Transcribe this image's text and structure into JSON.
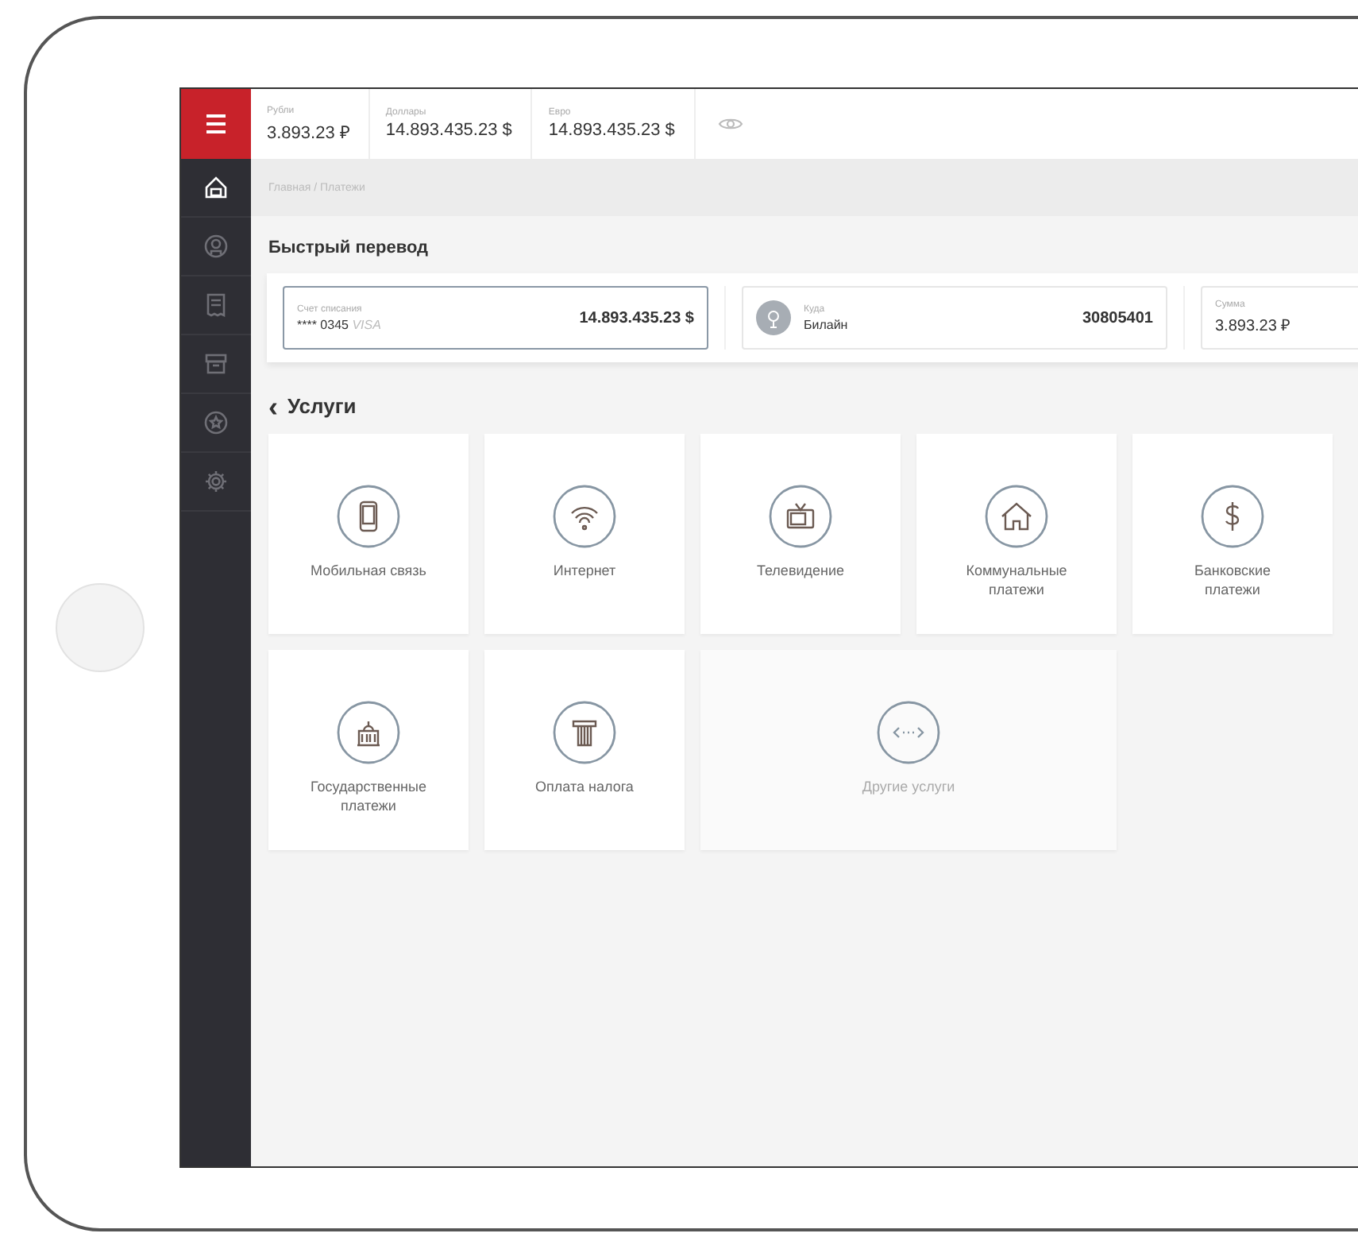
{
  "sidebar": {
    "items": [
      {
        "selected": true
      },
      {
        "selected": false
      },
      {
        "selected": false
      },
      {
        "selected": false
      },
      {
        "selected": false
      },
      {
        "selected": false
      }
    ]
  },
  "balances": [
    {
      "label": "Рубли",
      "value": "3.893.23 ₽"
    },
    {
      "label": "Доллары",
      "value": "14.893.435.23 $"
    },
    {
      "label": "Евро",
      "value": "14.893.435.23 $"
    }
  ],
  "breadcrumb": "Главная / Платежи",
  "quick_transfer": {
    "title": "Быстрый перевод",
    "from": {
      "label": "Счет списания",
      "card": "**** 0345",
      "brand": "VISA",
      "amount": "14.893.435.23 $"
    },
    "to": {
      "label": "Куда",
      "value": "Билайн",
      "number": "30805401"
    },
    "sum": {
      "label": "Сумма",
      "value": "3.893.23 ₽"
    }
  },
  "services": {
    "title": "Услуги",
    "back_icon": "‹",
    "items": [
      {
        "kind": "tile",
        "label": "Мобильная связь"
      },
      {
        "kind": "tile",
        "label": "Интернет"
      },
      {
        "kind": "tile",
        "label": "Телевидение"
      },
      {
        "kind": "tile",
        "label": "Коммунальные платежи"
      },
      {
        "kind": "tile",
        "label": "Банковские платежи"
      },
      {
        "kind": "tile",
        "label": "Государственные платежи"
      },
      {
        "kind": "tile",
        "label": "Оплата налога"
      },
      {
        "kind": "wide",
        "label": "Другие услуги"
      }
    ]
  }
}
